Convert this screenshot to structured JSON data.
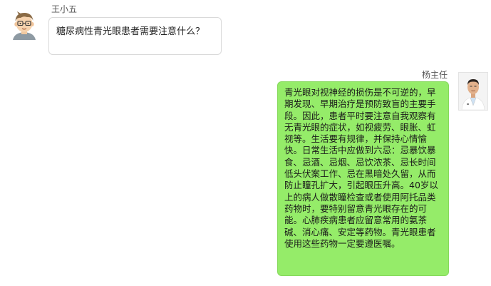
{
  "messages": [
    {
      "sender": "王小五",
      "side": "left",
      "text": "糖尿病性青光眼患者需要注意什么？"
    },
    {
      "sender": "杨主任",
      "side": "right",
      "text": "青光眼对视神经的损伤是不可逆的，早期发现、早期治疗是预防致盲的主要手段。因此，患者平时要注意自我观察有无青光眼的症状，如视疲劳、眼胀、虹视等。生活要有规律，并保持心情愉快。日常生活中应做到六忌：忌暴饮暴食、忌酒、忌烟、忌饮浓茶、忌长时间低头伏案工作、忌在黑暗处久留，从而防止瞳孔扩大，引起眼压升高。40岁以上的病人做散瞳检查或者使用阿托品类药物时，要特别留意青光眼存在的可能。心肺疾病患者应留意常用的氨茶碱、消心痛、安定等药物。青光眼患者使用这些药物一定要遵医嘱。"
    }
  ],
  "colors": {
    "doctor_bubble": "#95ec69",
    "patient_bubble": "#ffffff"
  },
  "icons": {
    "patient_avatar": "cartoon-boy-avatar",
    "doctor_avatar": "doctor-photo-avatar"
  }
}
